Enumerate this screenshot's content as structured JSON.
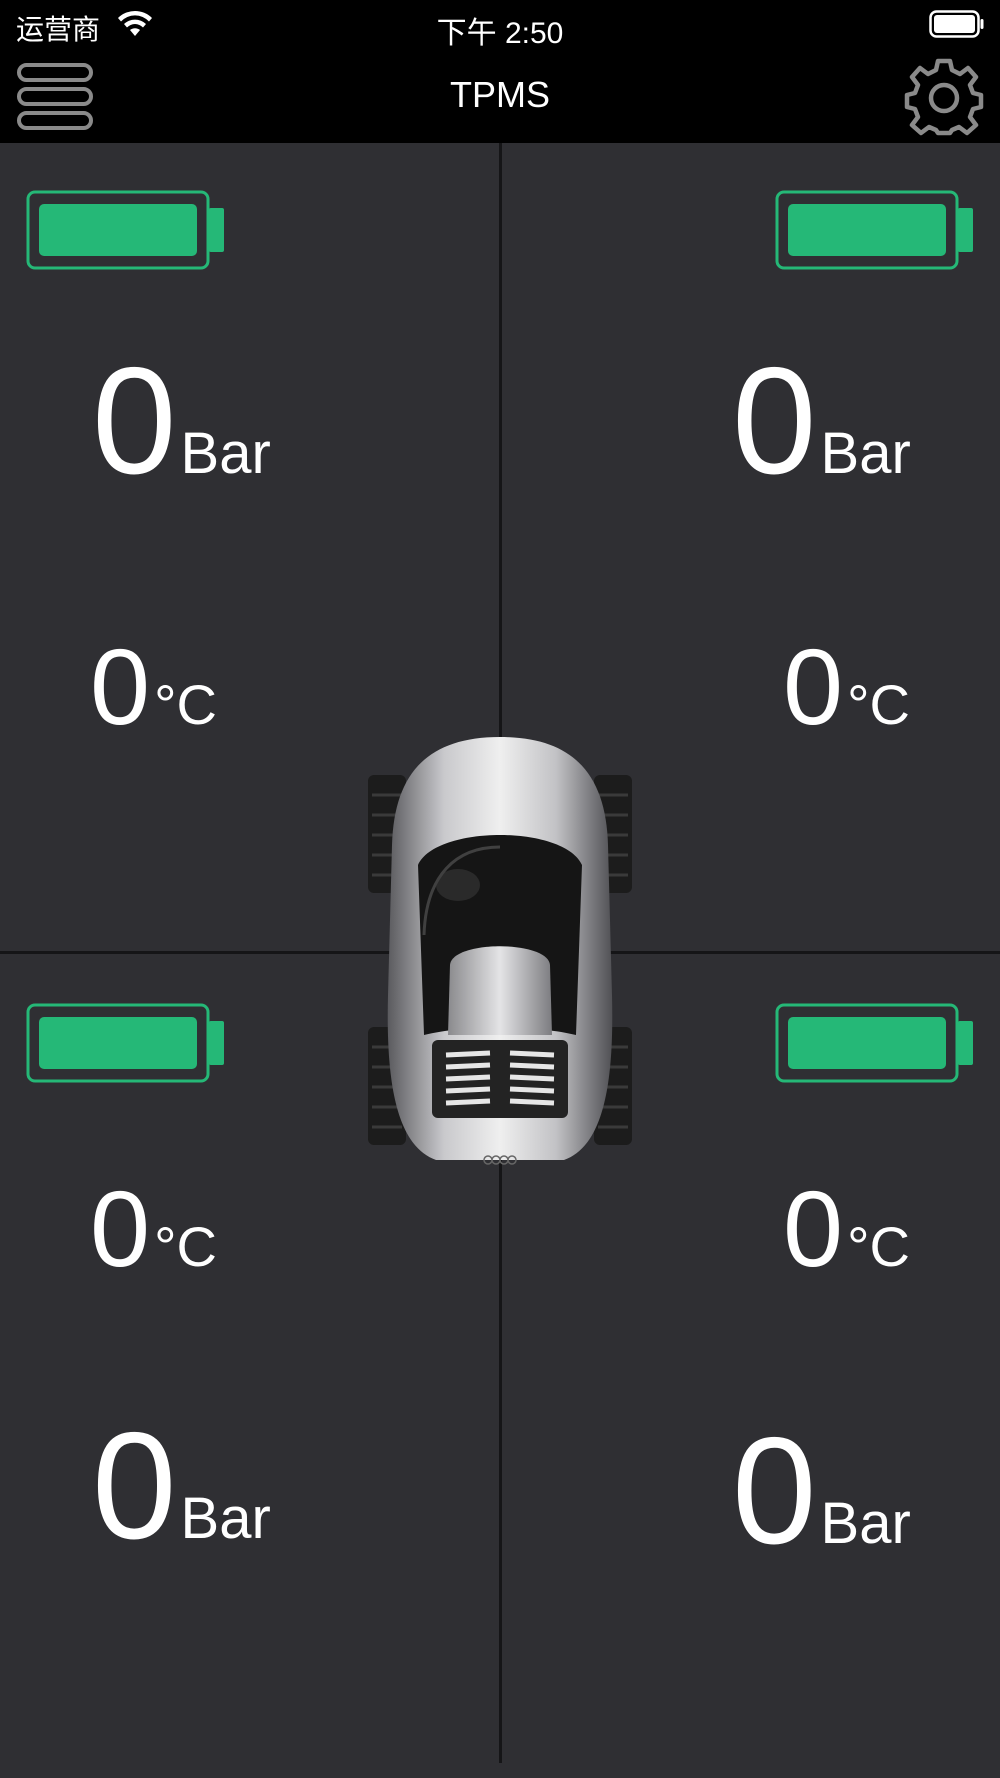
{
  "status_bar": {
    "carrier": "运营商",
    "time": "下午 2:50"
  },
  "nav": {
    "title": "TPMS",
    "menu_icon": "hamburger-menu-icon",
    "settings_icon": "gear-icon"
  },
  "colors": {
    "battery": "#25b877",
    "panel": "#2f2f33",
    "bar": "#000000"
  },
  "tires": {
    "front_left": {
      "pressure": "0",
      "pressure_unit": "Bar",
      "temperature": "0",
      "temperature_unit": "°C",
      "battery_level": 1.0
    },
    "front_right": {
      "pressure": "0",
      "pressure_unit": "Bar",
      "temperature": "0",
      "temperature_unit": "°C",
      "battery_level": 1.0
    },
    "rear_left": {
      "pressure": "0",
      "pressure_unit": "Bar",
      "temperature": "0",
      "temperature_unit": "°C",
      "battery_level": 1.0
    },
    "rear_right": {
      "pressure": "0",
      "pressure_unit": "Bar",
      "temperature": "0",
      "temperature_unit": "°C",
      "battery_level": 1.0
    }
  }
}
